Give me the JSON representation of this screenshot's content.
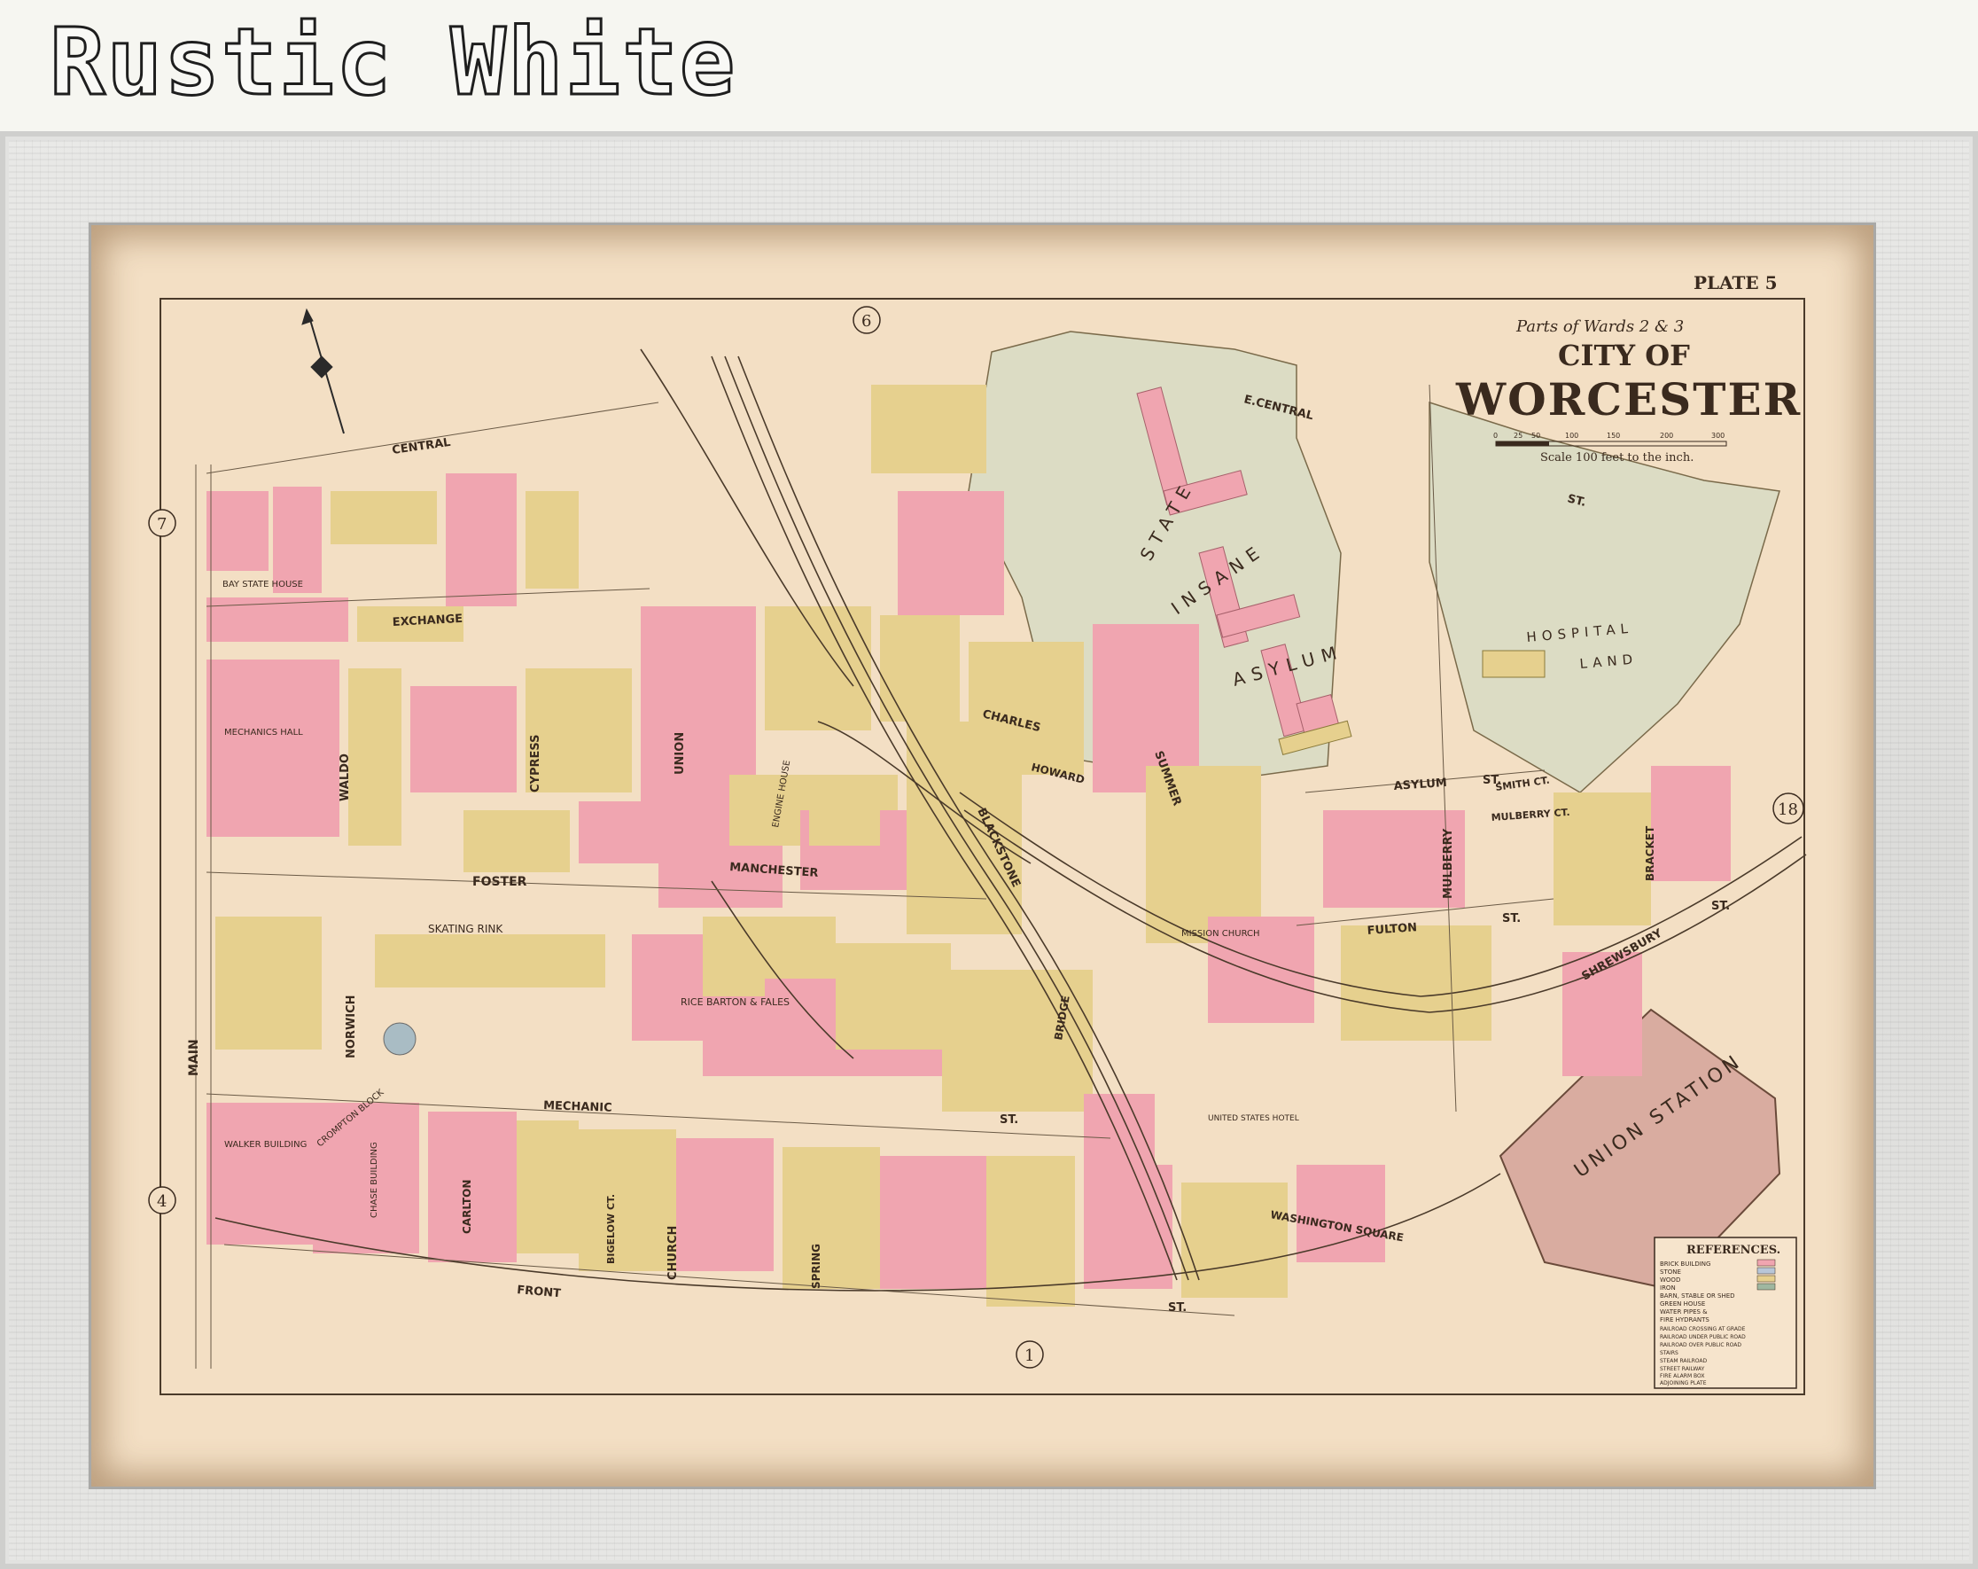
{
  "banner": {
    "title": "Rustic White"
  },
  "map": {
    "plate": "PLATE 5",
    "header_parts": "Parts of Wards 2 & 3",
    "header_city": "CITY OF",
    "header_name": "WORCESTER",
    "scale_text": "Scale 100 feet to the inch.",
    "scale_ticks": [
      "0",
      "25",
      "50",
      "100",
      "150",
      "200",
      "300"
    ],
    "ward_numbers": {
      "w6": "6",
      "w7": "7",
      "w4": "4",
      "w1": "1",
      "w18": "18"
    },
    "streets": {
      "central": "CENTRAL",
      "e_central": "E.CENTRAL",
      "st_e_central": "ST.",
      "exchange": "EXCHANGE",
      "foster": "FOSTER",
      "manchester": "MANCHESTER",
      "mechanic": "MECHANIC",
      "mechanic_st": "ST.",
      "front": "FRONT",
      "front_st": "ST.",
      "main": "MAIN",
      "waldo": "WALDO",
      "cypress": "CYPRESS",
      "union": "UNION",
      "norwich": "NORWICH",
      "charles": "CHARLES",
      "howard": "HOWARD",
      "blackstone": "BLACKSTONE",
      "summer": "SUMMER",
      "asylum": "ASYLUM",
      "asylum_st": "ST.",
      "fulton": "FULTON",
      "fulton_st": "ST.",
      "mulberry": "MULBERRY",
      "mulberry_ct": "MULBERRY CT.",
      "smith_ct": "SMITH CT.",
      "bracket": "BRACKET",
      "shrewsbury": "SHREWSBURY",
      "shrewsbury_st": "ST.",
      "bridge": "BRIDGE",
      "church": "CHURCH",
      "spring": "SPRING",
      "carlton": "CARLTON",
      "bigelow_ct": "BIGELOW CT.",
      "washington_square": "WASHINGTON SQUARE"
    },
    "places": {
      "state": "STATE",
      "insane": "INSANE",
      "asylum": "ASYLUM",
      "hospital": "HOSPITAL",
      "land": "LAND",
      "union_station": "UNION STATION",
      "skating_rink": "SKATING RINK",
      "mechanics_hall": "MECHANICS HALL",
      "bay_state_house": "BAY STATE HOUSE",
      "mission_church": "MISSION CHURCH",
      "united_states_hotel": "UNITED STATES HOTEL",
      "walker_building": "WALKER BUILDING",
      "crompton_block": "CROMPTON BLOCK",
      "chase_building": "CHASE BUILDING",
      "rice_barton": "RICE BARTON & FALES",
      "engine_house": "ENGINE HOUSE"
    },
    "legend": {
      "title": "REFERENCES.",
      "items": [
        "BRICK BUILDING",
        "STONE",
        "WOOD",
        "IRON",
        "BARN, STABLE OR SHED",
        "GREEN HOUSE",
        "WATER PIPES &",
        "FIRE HYDRANTS",
        "RAILROAD CROSSING AT GRADE",
        "RAILROAD UNDER PUBLIC ROAD",
        "RAILROAD OVER PUBLIC ROAD",
        "STAIRS",
        "STEAM RAILROAD",
        "STREET RAILWAY",
        "FIRE ALARM BOX",
        "ADJOINING PLATE"
      ]
    },
    "colors": {
      "paper": "#f3dfc4",
      "brick_pink": "#f0a5b0",
      "wood_yellow": "#e6d08e",
      "green_land": "#dcdcc4",
      "station": "#d9aca0",
      "frame": "#e3e3e1"
    }
  }
}
